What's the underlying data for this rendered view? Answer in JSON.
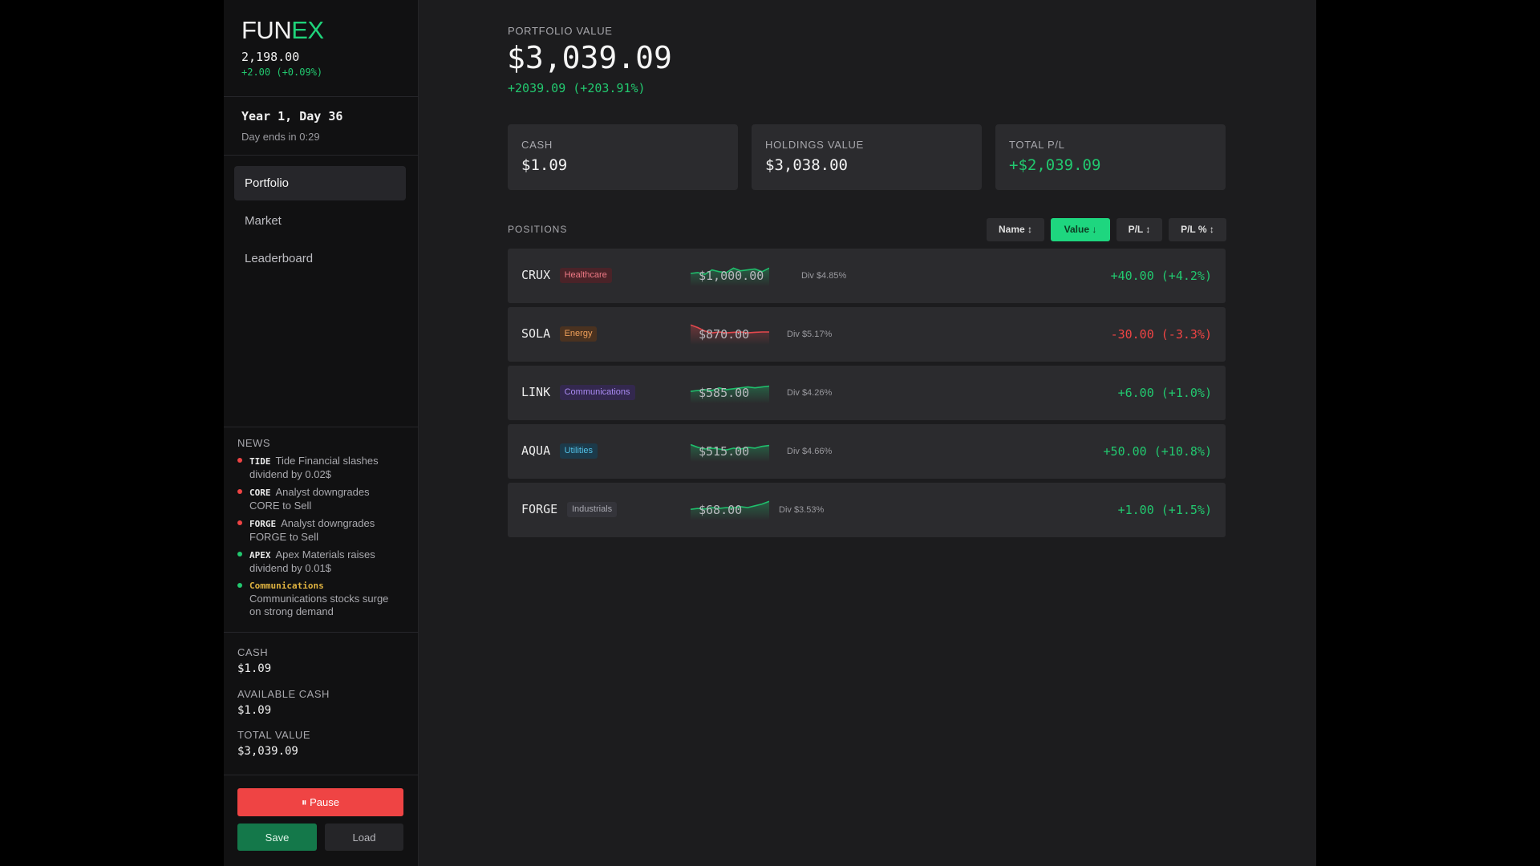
{
  "logo": {
    "part1": "FUN",
    "part2": "EX"
  },
  "index": {
    "value": "2,198.00",
    "change": "+2.00 (+0.09%)"
  },
  "day": {
    "label": "Year 1, Day 36",
    "ends": "Day ends in 0:29"
  },
  "nav": [
    {
      "label": "Portfolio",
      "active": true
    },
    {
      "label": "Market",
      "active": false
    },
    {
      "label": "Leaderboard",
      "active": false
    }
  ],
  "news": {
    "title": "NEWS",
    "items": [
      {
        "ticker": "TIDE",
        "text": "Tide Financial slashes dividend by 0.02$",
        "dot": "#ef4444"
      },
      {
        "ticker": "CORE",
        "text": "Analyst downgrades CORE to Sell",
        "dot": "#ef4444"
      },
      {
        "ticker": "FORGE",
        "text": "Analyst downgrades FORGE to Sell",
        "dot": "#ef4444"
      },
      {
        "ticker": "APEX",
        "text": "Apex Materials raises dividend by 0.01$",
        "dot": "#22c86f"
      },
      {
        "ticker": "Communications",
        "text": "Communications stocks surge on strong demand",
        "dot": "#22c86f"
      }
    ]
  },
  "sidebar_stats": {
    "cash_label": "CASH",
    "cash_value": "$1.09",
    "available_label": "AVAILABLE CASH",
    "available_value": "$1.09",
    "total_label": "TOTAL VALUE",
    "total_value": "$3,039.09"
  },
  "controls": {
    "pause": "⏸ Pause",
    "save": "Save",
    "load": "Load"
  },
  "portfolio": {
    "label": "PORTFOLIO VALUE",
    "value": "$3,039.09",
    "change": "+2039.09 (+203.91%)"
  },
  "cards": [
    {
      "label": "CASH",
      "value": "$1.09",
      "positive": false
    },
    {
      "label": "HOLDINGS VALUE",
      "value": "$3,038.00",
      "positive": false
    },
    {
      "label": "TOTAL P/L",
      "value": "+$2,039.09",
      "positive": true
    }
  ],
  "positions": {
    "label": "POSITIONS",
    "sort_buttons": [
      {
        "label": "Name ↕",
        "active": false
      },
      {
        "label": "Value ↓",
        "active": true
      },
      {
        "label": "P/L ↕",
        "active": false
      },
      {
        "label": "P/L % ↕",
        "active": false
      }
    ],
    "rows": [
      {
        "ticker": "CRUX",
        "sector": "Healthcare",
        "sector_bg": "#4a2328",
        "sector_fg": "#f07a86",
        "value": "$1,000.00",
        "div": "Div $4.85%",
        "pl": "+40.00 (+4.2%)",
        "positive": true,
        "spark": [
          0.5,
          0.45,
          0.55,
          0.3,
          0.4,
          0.45,
          0.2,
          0.35,
          0.3,
          0.25,
          0.4,
          0.2
        ]
      },
      {
        "ticker": "SOLA",
        "sector": "Energy",
        "sector_bg": "#4a3220",
        "sector_fg": "#f0a05a",
        "value": "$870.00",
        "div": "Div $5.17%",
        "pl": "-30.00 (-3.3%)",
        "positive": false,
        "spark": [
          0.1,
          0.25,
          0.45,
          0.55,
          0.5,
          0.55,
          0.52,
          0.5,
          0.55,
          0.52,
          0.5,
          0.5
        ]
      },
      {
        "ticker": "LINK",
        "sector": "Communications",
        "sector_bg": "#33284e",
        "sector_fg": "#a98af2",
        "value": "$585.00",
        "div": "Div $4.26%",
        "pl": "+6.00 (+1.0%)",
        "positive": true,
        "spark": [
          0.55,
          0.5,
          0.45,
          0.5,
          0.35,
          0.45,
          0.4,
          0.35,
          0.3,
          0.35,
          0.3,
          0.25
        ]
      },
      {
        "ticker": "AQUA",
        "sector": "Utilities",
        "sector_bg": "#1c3a4a",
        "sector_fg": "#52c2e8",
        "value": "$515.00",
        "div": "Div $4.66%",
        "pl": "+50.00 (+10.8%)",
        "positive": true,
        "spark": [
          0.25,
          0.4,
          0.5,
          0.45,
          0.5,
          0.55,
          0.45,
          0.5,
          0.4,
          0.45,
          0.35,
          0.3
        ]
      },
      {
        "ticker": "FORGE",
        "sector": "Industrials",
        "sector_bg": "#34343a",
        "sector_fg": "#a8a8b0",
        "value": "$68.00",
        "div": "Div $3.53%",
        "pl": "+1.00 (+1.5%)",
        "positive": true,
        "spark": [
          0.6,
          0.55,
          0.58,
          0.5,
          0.55,
          0.5,
          0.52,
          0.45,
          0.5,
          0.4,
          0.3,
          0.15
        ]
      }
    ]
  }
}
